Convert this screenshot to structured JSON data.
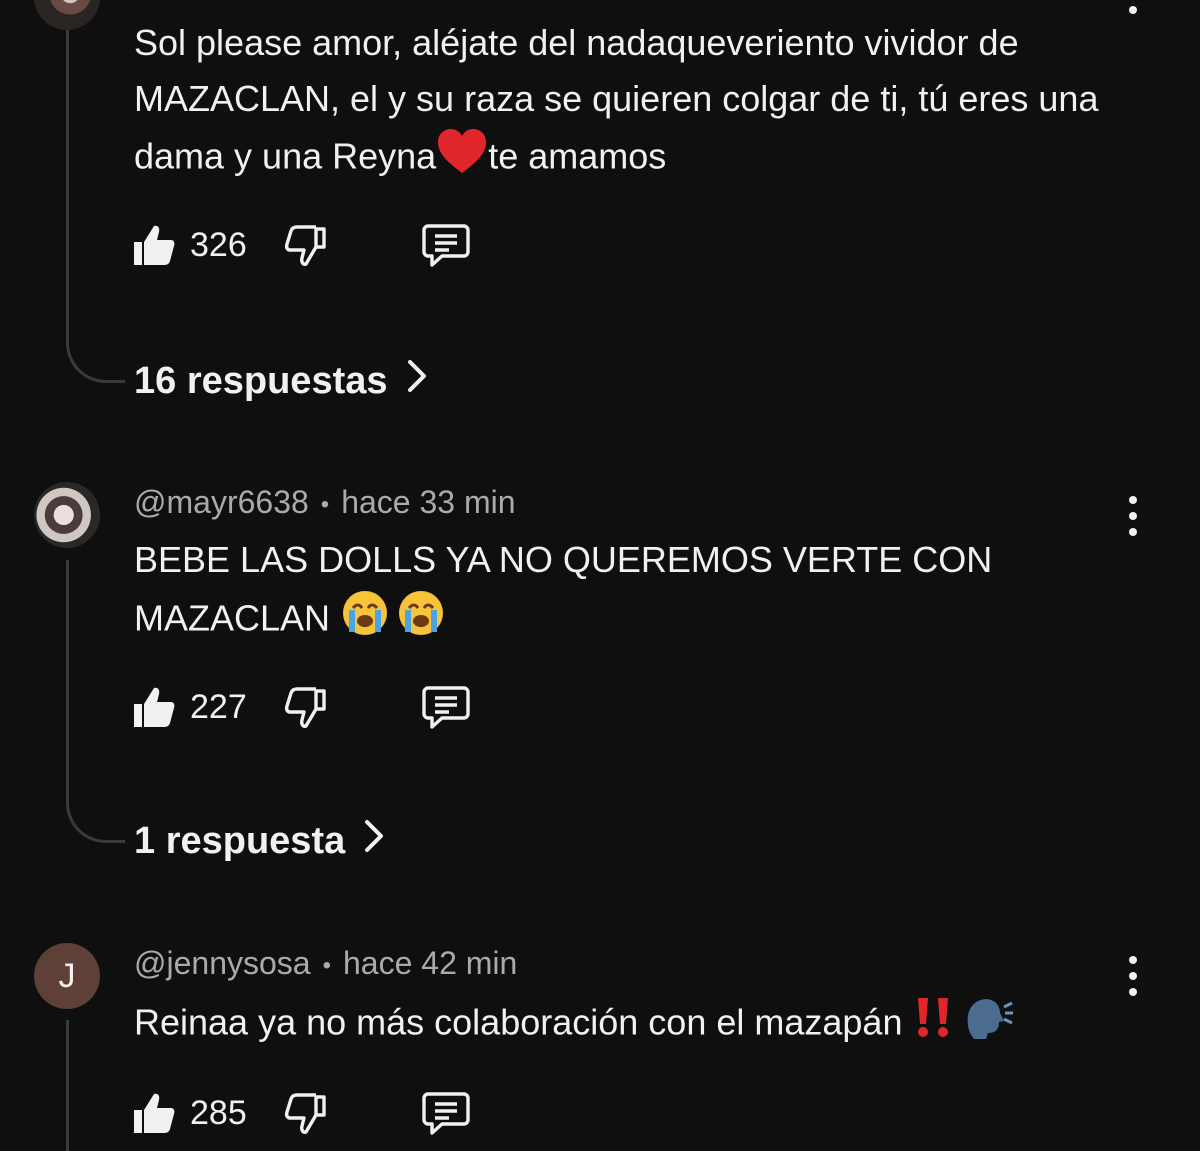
{
  "comments": [
    {
      "text_part1": "Sol please amor, aléjate del nadaqueveriento vividor de MAZACLAN, el y su raza se quieren colgar de ti, tú eres una dama y una Reyna",
      "text_part2": "te amamos",
      "emoji": "heart",
      "likes": "326",
      "replies": "16 respuestas"
    },
    {
      "author": "@mayr6638",
      "time": "hace 33 min",
      "text": "BEBE LAS DOLLS YA NO QUEREMOS VERTE CON MAZACLAN",
      "emoji": "loudly-crying-face x2",
      "likes": "227",
      "replies": "1 respuesta"
    },
    {
      "author": "@jennysosa",
      "avatar_letter": "J",
      "time": "hace 42 min",
      "text": "Reinaa ya no más colaboración con el mazapán",
      "emoji": "double-exclamation, speaking-head",
      "likes": "285"
    }
  ],
  "separator": "•",
  "colors": {
    "background": "#0f0f0f",
    "text": "#f1f1f1",
    "meta": "#aaaaaa",
    "thread": "#3a3a3a",
    "avatar_j": "#5e4036"
  }
}
